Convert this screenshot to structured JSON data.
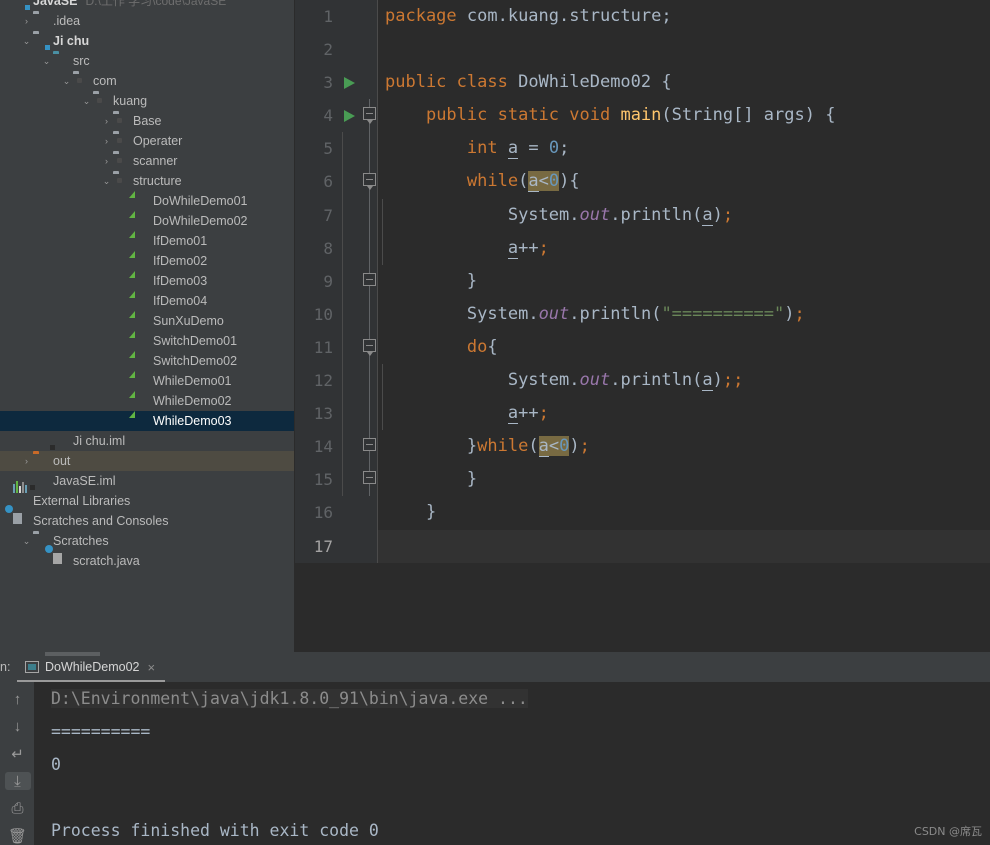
{
  "project": {
    "name": "JavaSE",
    "path": "D:\\工作 学习\\code\\JavaSE",
    "tree": [
      {
        "label": ".idea",
        "indent": 1,
        "arrow": "›",
        "icon": "folder-icon",
        "state": ""
      },
      {
        "label": "Ji chu",
        "indent": 1,
        "arrow": "⌄",
        "icon": "module-folder-icon",
        "state": "bold"
      },
      {
        "label": "src",
        "indent": 2,
        "arrow": "⌄",
        "icon": "source-folder-icon",
        "state": ""
      },
      {
        "label": "com",
        "indent": 3,
        "arrow": "⌄",
        "icon": "package-icon",
        "state": ""
      },
      {
        "label": "kuang",
        "indent": 4,
        "arrow": "⌄",
        "icon": "package-icon",
        "state": ""
      },
      {
        "label": "Base",
        "indent": 5,
        "arrow": "›",
        "icon": "package-icon",
        "state": ""
      },
      {
        "label": "Operater",
        "indent": 5,
        "arrow": "›",
        "icon": "package-icon",
        "state": ""
      },
      {
        "label": "scanner",
        "indent": 5,
        "arrow": "›",
        "icon": "package-icon",
        "state": ""
      },
      {
        "label": "structure",
        "indent": 5,
        "arrow": "⌄",
        "icon": "package-icon",
        "state": ""
      },
      {
        "label": "DoWhileDemo01",
        "indent": 6,
        "arrow": "",
        "icon": "java-class-icon",
        "state": ""
      },
      {
        "label": "DoWhileDemo02",
        "indent": 6,
        "arrow": "",
        "icon": "java-class-icon",
        "state": ""
      },
      {
        "label": "IfDemo01",
        "indent": 6,
        "arrow": "",
        "icon": "java-class-icon",
        "state": ""
      },
      {
        "label": "IfDemo02",
        "indent": 6,
        "arrow": "",
        "icon": "java-class-icon",
        "state": ""
      },
      {
        "label": "IfDemo03",
        "indent": 6,
        "arrow": "",
        "icon": "java-class-icon",
        "state": ""
      },
      {
        "label": "IfDemo04",
        "indent": 6,
        "arrow": "",
        "icon": "java-class-icon",
        "state": ""
      },
      {
        "label": "SunXuDemo",
        "indent": 6,
        "arrow": "",
        "icon": "java-class-icon",
        "state": ""
      },
      {
        "label": "SwitchDemo01",
        "indent": 6,
        "arrow": "",
        "icon": "java-class-icon",
        "state": ""
      },
      {
        "label": "SwitchDemo02",
        "indent": 6,
        "arrow": "",
        "icon": "java-class-icon",
        "state": ""
      },
      {
        "label": "WhileDemo01",
        "indent": 6,
        "arrow": "",
        "icon": "java-class-icon",
        "state": ""
      },
      {
        "label": "WhileDemo02",
        "indent": 6,
        "arrow": "",
        "icon": "java-class-icon",
        "state": ""
      },
      {
        "label": "WhileDemo03",
        "indent": 6,
        "arrow": "",
        "icon": "java-class-icon",
        "state": "selected"
      },
      {
        "label": "Ji chu.iml",
        "indent": 2,
        "arrow": "",
        "icon": "iml-file-icon",
        "state": ""
      },
      {
        "label": "out",
        "indent": 1,
        "arrow": "›",
        "icon": "output-folder-icon",
        "state": "highlight"
      },
      {
        "label": "JavaSE.iml",
        "indent": 1,
        "arrow": "",
        "icon": "iml-file-icon",
        "state": ""
      },
      {
        "label": "External Libraries",
        "indent": 0,
        "arrow": "",
        "icon": "libraries-icon",
        "state": ""
      },
      {
        "label": "Scratches and Consoles",
        "indent": 0,
        "arrow": "",
        "icon": "scratches-icon",
        "state": ""
      },
      {
        "label": "Scratches",
        "indent": 1,
        "arrow": "⌄",
        "icon": "folder-icon",
        "state": ""
      },
      {
        "label": "scratch.java",
        "indent": 2,
        "arrow": "",
        "icon": "scratch-java-icon",
        "state": ""
      }
    ]
  },
  "editor": {
    "file": "DoWhileDemo02.java",
    "current_line": 17,
    "lines": [
      {
        "n": 1,
        "run": false,
        "fold": "",
        "guides": 0,
        "tokens": [
          {
            "t": "package ",
            "c": "kw"
          },
          {
            "t": "com.kuang.structure",
            "c": "pln"
          },
          {
            "t": ";",
            "c": "pln"
          }
        ]
      },
      {
        "n": 2,
        "run": false,
        "fold": "",
        "guides": 0,
        "tokens": []
      },
      {
        "n": 3,
        "run": true,
        "fold": "",
        "guides": 0,
        "tokens": [
          {
            "t": "public ",
            "c": "kw"
          },
          {
            "t": "class ",
            "c": "kw"
          },
          {
            "t": "DoWhileDemo02",
            "c": "cls"
          },
          {
            "t": " {",
            "c": "pln"
          }
        ]
      },
      {
        "n": 4,
        "run": true,
        "fold": "minus",
        "guides": 0,
        "tokens": [
          {
            "t": "    ",
            "c": "pln"
          },
          {
            "t": "public ",
            "c": "kw"
          },
          {
            "t": "static ",
            "c": "kw"
          },
          {
            "t": "void ",
            "c": "kw"
          },
          {
            "t": "main",
            "c": "mth"
          },
          {
            "t": "(",
            "c": "pln"
          },
          {
            "t": "String",
            "c": "cls"
          },
          {
            "t": "[] args) {",
            "c": "pln"
          }
        ]
      },
      {
        "n": 5,
        "run": false,
        "fold": "",
        "guides": 1,
        "tokens": [
          {
            "t": "        ",
            "c": "pln"
          },
          {
            "t": "int ",
            "c": "kw"
          },
          {
            "t": "a",
            "c": "lv"
          },
          {
            "t": " = ",
            "c": "pln"
          },
          {
            "t": "0",
            "c": "num"
          },
          {
            "t": ";",
            "c": "pln"
          }
        ]
      },
      {
        "n": 6,
        "run": false,
        "fold": "minus",
        "guides": 1,
        "tokens": [
          {
            "t": "        ",
            "c": "pln"
          },
          {
            "t": "while",
            "c": "kw"
          },
          {
            "t": "(",
            "c": "pln"
          },
          {
            "t": "a",
            "c": "lv hl"
          },
          {
            "t": "<",
            "c": "pln hl"
          },
          {
            "t": "0",
            "c": "num hl"
          },
          {
            "t": "){",
            "c": "pln"
          }
        ]
      },
      {
        "n": 7,
        "run": false,
        "fold": "",
        "guides": 2,
        "tokens": [
          {
            "t": "            ",
            "c": "pln"
          },
          {
            "t": "System",
            "c": "cls"
          },
          {
            "t": ".",
            "c": "pln"
          },
          {
            "t": "out",
            "c": "fld"
          },
          {
            "t": ".",
            "c": "pln"
          },
          {
            "t": "println",
            "c": "pln"
          },
          {
            "t": "(",
            "c": "pln"
          },
          {
            "t": "a",
            "c": "lv"
          },
          {
            "t": ")",
            "c": "pln"
          },
          {
            "t": ";",
            "c": "kw"
          }
        ]
      },
      {
        "n": 8,
        "run": false,
        "fold": "",
        "guides": 2,
        "tokens": [
          {
            "t": "            ",
            "c": "pln"
          },
          {
            "t": "a",
            "c": "lv"
          },
          {
            "t": "++",
            "c": "pln"
          },
          {
            "t": ";",
            "c": "kw"
          }
        ]
      },
      {
        "n": 9,
        "run": false,
        "fold": "end",
        "guides": 1,
        "tokens": [
          {
            "t": "        }",
            "c": "pln"
          }
        ]
      },
      {
        "n": 10,
        "run": false,
        "fold": "",
        "guides": 1,
        "tokens": [
          {
            "t": "        ",
            "c": "pln"
          },
          {
            "t": "System",
            "c": "cls"
          },
          {
            "t": ".",
            "c": "pln"
          },
          {
            "t": "out",
            "c": "fld"
          },
          {
            "t": ".",
            "c": "pln"
          },
          {
            "t": "println",
            "c": "pln"
          },
          {
            "t": "(",
            "c": "pln"
          },
          {
            "t": "\"==========\"",
            "c": "str"
          },
          {
            "t": ")",
            "c": "pln"
          },
          {
            "t": ";",
            "c": "kw"
          }
        ]
      },
      {
        "n": 11,
        "run": false,
        "fold": "minus",
        "guides": 1,
        "tokens": [
          {
            "t": "        ",
            "c": "pln"
          },
          {
            "t": "do",
            "c": "kw"
          },
          {
            "t": "{",
            "c": "pln"
          }
        ]
      },
      {
        "n": 12,
        "run": false,
        "fold": "",
        "guides": 2,
        "tokens": [
          {
            "t": "            ",
            "c": "pln"
          },
          {
            "t": "System",
            "c": "cls"
          },
          {
            "t": ".",
            "c": "pln"
          },
          {
            "t": "out",
            "c": "fld"
          },
          {
            "t": ".",
            "c": "pln"
          },
          {
            "t": "println",
            "c": "pln"
          },
          {
            "t": "(",
            "c": "pln"
          },
          {
            "t": "a",
            "c": "lv"
          },
          {
            "t": ")",
            "c": "pln"
          },
          {
            "t": ";;",
            "c": "kw"
          }
        ]
      },
      {
        "n": 13,
        "run": false,
        "fold": "",
        "guides": 2,
        "tokens": [
          {
            "t": "            ",
            "c": "pln"
          },
          {
            "t": "a",
            "c": "lv"
          },
          {
            "t": "++",
            "c": "pln"
          },
          {
            "t": ";",
            "c": "kw"
          }
        ]
      },
      {
        "n": 14,
        "run": false,
        "fold": "end",
        "guides": 1,
        "tokens": [
          {
            "t": "        }",
            "c": "pln"
          },
          {
            "t": "while",
            "c": "kw"
          },
          {
            "t": "(",
            "c": "pln"
          },
          {
            "t": "a",
            "c": "lv hl"
          },
          {
            "t": "<",
            "c": "pln hl"
          },
          {
            "t": "0",
            "c": "num hl"
          },
          {
            "t": ")",
            "c": "pln"
          },
          {
            "t": ";",
            "c": "kw"
          }
        ]
      },
      {
        "n": 15,
        "run": false,
        "fold": "end",
        "guides": 1,
        "tokens": [
          {
            "t": "        }",
            "c": "pln"
          }
        ]
      },
      {
        "n": 16,
        "run": false,
        "fold": "",
        "guides": 0,
        "tokens": [
          {
            "t": "    }",
            "c": "pln"
          }
        ]
      },
      {
        "n": 17,
        "run": false,
        "fold": "",
        "guides": 0,
        "tokens": []
      }
    ]
  },
  "run_panel": {
    "label": "n:",
    "tab": {
      "title": "DoWhileDemo02",
      "close": "×"
    },
    "toolbar": [
      {
        "name": "up-arrow-icon",
        "glyph": "↑",
        "active": false
      },
      {
        "name": "down-arrow-icon",
        "glyph": "↓",
        "active": false
      },
      {
        "name": "soft-wrap-icon",
        "glyph": "↵",
        "active": false
      },
      {
        "name": "scroll-to-end-icon",
        "glyph": "⤓",
        "active": true
      },
      {
        "name": "print-icon",
        "glyph": "⎙",
        "active": false
      },
      {
        "name": "trash-icon",
        "glyph": "🗑",
        "active": false
      }
    ],
    "console": [
      {
        "text": "D:\\Environment\\java\\jdk1.8.0_91\\bin\\java.exe ...",
        "kind": "cmd"
      },
      {
        "text": "==========",
        "kind": "out"
      },
      {
        "text": "0",
        "kind": "out"
      },
      {
        "text": "",
        "kind": "out"
      },
      {
        "text": "Process finished with exit code 0",
        "kind": "out"
      }
    ]
  },
  "watermark": "CSDN @席瓦",
  "colors": {
    "panel_bg": "#3c3f41",
    "editor_bg": "#2b2b2b",
    "gutter_bg": "#313335",
    "selection": "#0d293e",
    "highlight_row": "#4e4b42",
    "keyword": "#cc7832",
    "string": "#6a8759",
    "number": "#6897bb",
    "field": "#9876aa",
    "method": "#ffc66d",
    "plain": "#a9b7c6",
    "search_highlight": "#786a42",
    "run_green": "#499c54"
  }
}
